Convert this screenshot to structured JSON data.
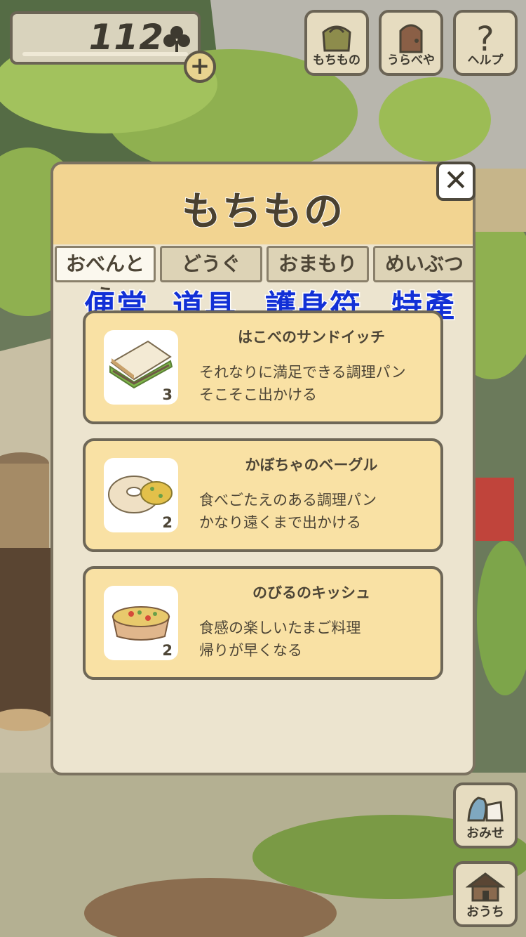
{
  "currency": {
    "count": "112",
    "icon": "clover-icon",
    "add_icon": "plus"
  },
  "top_buttons": [
    {
      "label": "もちもの",
      "icon": "bag-icon"
    },
    {
      "label": "うらべや",
      "icon": "door-icon"
    },
    {
      "label": "ヘルプ",
      "icon": "question-icon"
    }
  ],
  "modal": {
    "title": "もちもの",
    "close_symbol": "✕",
    "tabs": [
      {
        "label": "おべんとう",
        "active": true
      },
      {
        "label": "どうぐ",
        "active": false
      },
      {
        "label": "おまもり",
        "active": false
      },
      {
        "label": "めいぶつ",
        "active": false
      }
    ],
    "tab_translations": [
      "便當",
      "道具",
      "護身符",
      "特產"
    ],
    "items": [
      {
        "name": "はこべのサンドイッチ",
        "qty": "3",
        "desc1": "それなりに満足できる調理パン",
        "desc2": "そこそこ出かける",
        "icon": "sandwich-icon"
      },
      {
        "name": "かぼちゃのベーグル",
        "qty": "2",
        "desc1": "食べごたえのある調理パン",
        "desc2": "かなり遠くまで出かける",
        "icon": "bagel-icon"
      },
      {
        "name": "のびるのキッシュ",
        "qty": "2",
        "desc1": "食感の楽しいたまご料理",
        "desc2": "帰りが早くなる",
        "icon": "quiche-icon"
      }
    ]
  },
  "side_buttons": [
    {
      "label": "おみせ",
      "icon": "shop-icon"
    },
    {
      "label": "おうち",
      "icon": "house-icon"
    }
  ],
  "colors": {
    "accent_blue": "#1230d6",
    "card_bg": "#f9e1a4",
    "header_bg": "#f2d491"
  }
}
